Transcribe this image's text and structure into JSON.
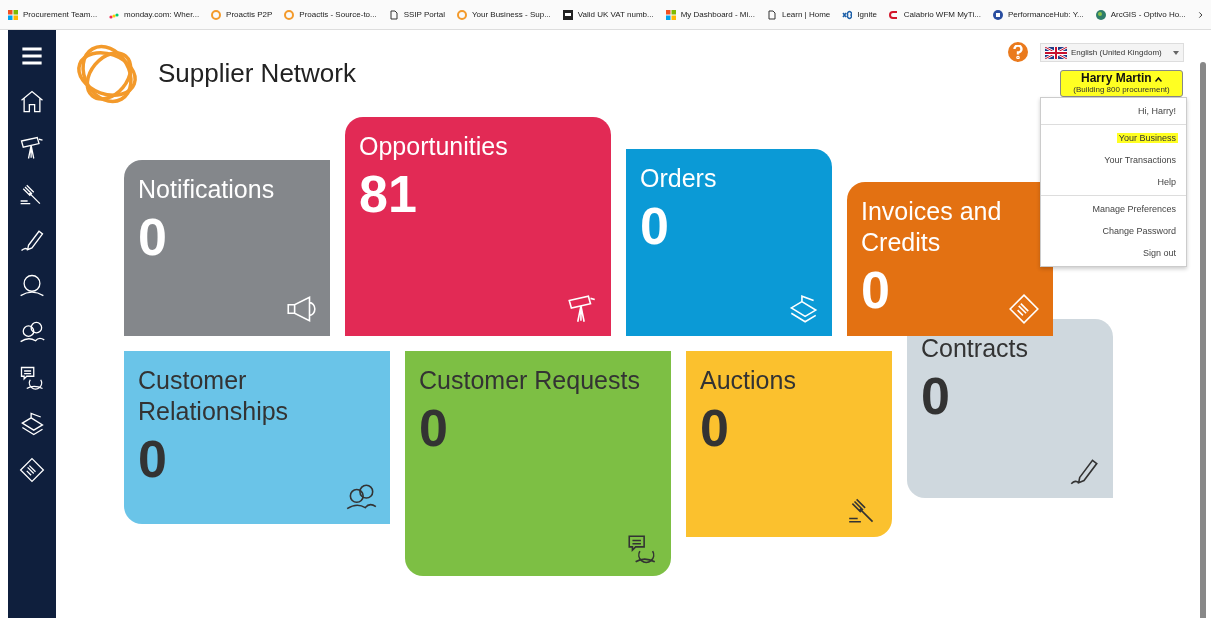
{
  "bookmarks": [
    {
      "label": "Procurement Team...",
      "kind": "windows"
    },
    {
      "label": "monday.com: Wher...",
      "kind": "monday"
    },
    {
      "label": "Proactis P2P",
      "kind": "proactis"
    },
    {
      "label": "Proactis - Source-to...",
      "kind": "proactis"
    },
    {
      "label": "SSIP Portal",
      "kind": "page"
    },
    {
      "label": "Your Business - Sup...",
      "kind": "proactis"
    },
    {
      "label": "Valid UK VAT numb...",
      "kind": "vat"
    },
    {
      "label": "My Dashboard - Mi...",
      "kind": "windows"
    },
    {
      "label": "Learn | Home",
      "kind": "page"
    },
    {
      "label": "Ignite",
      "kind": "ignite"
    },
    {
      "label": "Calabrio WFM MyTi...",
      "kind": "calabrio"
    },
    {
      "label": "PerformanceHub: Y...",
      "kind": "hub"
    },
    {
      "label": "ArcGIS - Optivo Ho...",
      "kind": "globe"
    }
  ],
  "sidebar": {
    "items": [
      {
        "kind": "menu"
      },
      {
        "kind": "home"
      },
      {
        "kind": "telescope"
      },
      {
        "kind": "gavel"
      },
      {
        "kind": "pen"
      },
      {
        "kind": "person"
      },
      {
        "kind": "people"
      },
      {
        "kind": "chat"
      },
      {
        "kind": "papers"
      },
      {
        "kind": "invoice"
      }
    ]
  },
  "header": {
    "title": "Supplier Network",
    "language": "English (United Kingdom)",
    "user": {
      "name": "Harry Martin",
      "organisation": "(Building 800 procurement)"
    },
    "menu": [
      [
        {
          "label": "Hi, Harry!",
          "selected": false
        }
      ],
      [
        {
          "label": "Your Business",
          "selected": true
        },
        {
          "label": "Your Transactions",
          "selected": false
        },
        {
          "label": "Help",
          "selected": false
        }
      ],
      [
        {
          "label": "Manage Preferences",
          "selected": false
        },
        {
          "label": "Change Password",
          "selected": false
        },
        {
          "label": "Sign out",
          "selected": false
        }
      ]
    ]
  },
  "tiles": [
    {
      "title": "Notifications",
      "count": "0",
      "color": "#84878b"
    },
    {
      "title": "Opportunities",
      "count": "81",
      "color": "#e22a55"
    },
    {
      "title": "Orders",
      "count": "0",
      "color": "#0b9ad6"
    },
    {
      "title": "Invoices and Credits",
      "count": "0",
      "color": "#e37112"
    },
    {
      "title": "Customer Relationships",
      "count": "0",
      "color": "#6ac4e8"
    },
    {
      "title": "Customer Requests",
      "count": "0",
      "color": "#7dbf44"
    },
    {
      "title": "Auctions",
      "count": "0",
      "color": "#fbc12e"
    },
    {
      "title": "Contracts",
      "count": "0",
      "color": "#cfd8de"
    }
  ]
}
